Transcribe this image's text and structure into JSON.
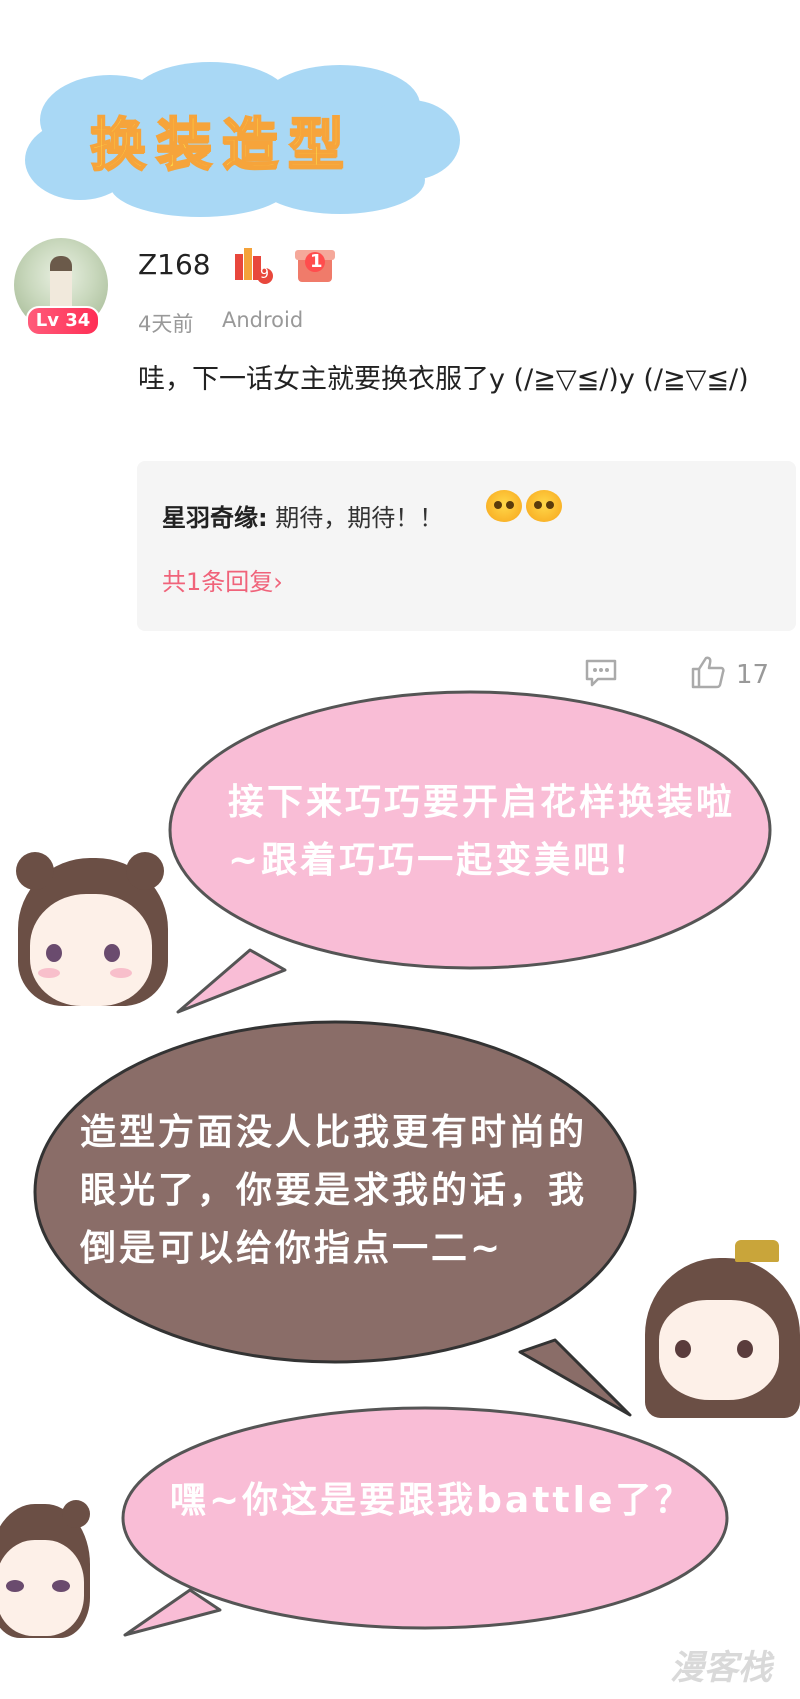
{
  "title_banner": {
    "text": "换装造型"
  },
  "comment": {
    "username": "Z168",
    "level": "Lv 34",
    "badge_books_number": "9",
    "badge_gift_number": "1",
    "time": "4天前",
    "device": "Android",
    "text": "哇，下一话女主就要换衣服了y (/≧▽≦/)y (/≧▽≦/)",
    "reply": {
      "author": "星羽奇缘:",
      "text": "期待，期待！！",
      "count_label": "共1条回复",
      "count_arrow": "›"
    },
    "like_count": "17",
    "icons": [
      "comment-icon",
      "thumbs-up-icon"
    ]
  },
  "dialogue": [
    {
      "speaker_position": "left",
      "text": "接下来巧巧要开启花样换装啦~跟着巧巧一起变美吧！",
      "bubble_color": "#f9bdd6"
    },
    {
      "speaker_position": "right",
      "text": "造型方面没人比我更有时尚的眼光了，你要是求我的话，我倒是可以给你指点一二~",
      "bubble_color": "#8a6d68"
    },
    {
      "speaker_position": "left",
      "text": "嘿~你这是要跟我battle了？",
      "bubble_color": "#f9bdd6"
    }
  ],
  "watermark": "漫客栈",
  "colors": {
    "cloud": "#a9d8f5",
    "title_fill": "#ffe34a",
    "pink_bubble": "#f9bdd6",
    "brown_bubble": "#8a6d68",
    "reply_link": "#f0637a"
  }
}
